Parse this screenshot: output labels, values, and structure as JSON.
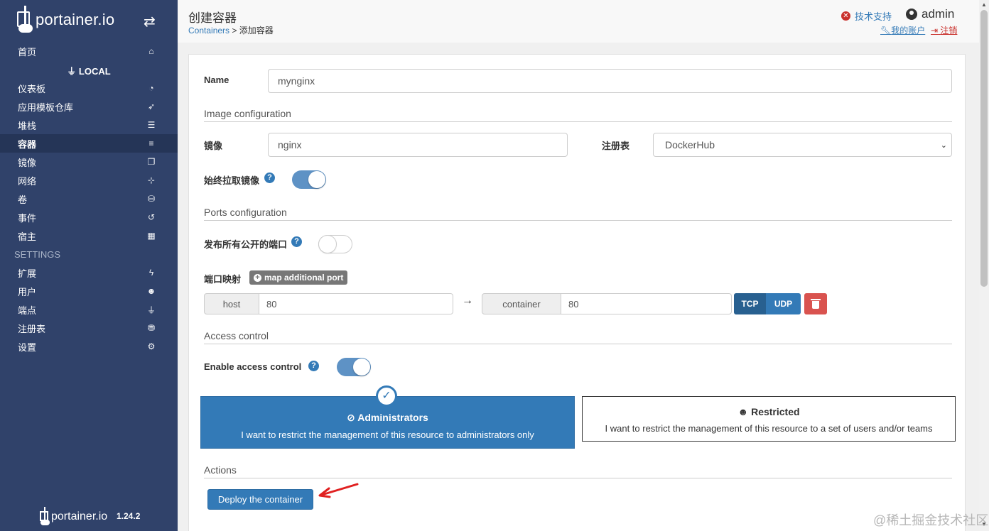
{
  "sidebar": {
    "logo_text": "portainer.io",
    "items_top": [
      {
        "label": "首页",
        "icon": "home-icon"
      }
    ],
    "local_label": "LOCAL",
    "items_local": [
      {
        "label": "仪表板",
        "icon": "dashboard-icon"
      },
      {
        "label": "应用模板仓库",
        "icon": "rocket-icon"
      },
      {
        "label": "堆栈",
        "icon": "th-list-icon"
      },
      {
        "label": "容器",
        "icon": "server-icon",
        "active": true
      },
      {
        "label": "镜像",
        "icon": "clone-icon"
      },
      {
        "label": "网络",
        "icon": "sitemap-icon"
      },
      {
        "label": "卷",
        "icon": "cubes-icon"
      },
      {
        "label": "事件",
        "icon": "history-icon"
      },
      {
        "label": "宿主",
        "icon": "th-icon"
      }
    ],
    "settings_label": "SETTINGS",
    "items_settings": [
      {
        "label": "扩展",
        "icon": "bolt-icon"
      },
      {
        "label": "用户",
        "icon": "users-icon"
      },
      {
        "label": "端点",
        "icon": "plug-icon"
      },
      {
        "label": "注册表",
        "icon": "database-icon"
      },
      {
        "label": "设置",
        "icon": "cogs-icon"
      }
    ],
    "footer_logo": "portainer.io",
    "version": "1.24.2"
  },
  "header": {
    "title": "创建容器",
    "breadcrumb_link": "Containers",
    "breadcrumb_sep": " > ",
    "breadcrumb_current": "添加容器",
    "support": "技术支持",
    "user": "admin",
    "my_account": "我的账户",
    "logout": "注销"
  },
  "form": {
    "name_label": "Name",
    "name_value": "mynginx",
    "image_section": "Image configuration",
    "image_label": "镜像",
    "image_value": "nginx",
    "registry_label": "注册表",
    "registry_value": "DockerHub",
    "always_pull_label": "始终拉取镜像",
    "always_pull": true,
    "ports_section": "Ports configuration",
    "publish_all_label": "发布所有公开的端口",
    "publish_all": false,
    "port_mapping_label": "端口映射",
    "map_port_button": "map additional port",
    "host_addon": "host",
    "host_value": "80",
    "container_addon": "container",
    "container_value": "80",
    "tcp": "TCP",
    "udp": "UDP",
    "access_section": "Access control",
    "enable_access_label": "Enable access control",
    "enable_access": true,
    "admin_title": "Administrators",
    "admin_desc": "I want to restrict the management of this resource to administrators only",
    "restricted_title": "Restricted",
    "restricted_desc": "I want to restrict the management of this resource to a set of users and/or teams",
    "actions_section": "Actions",
    "deploy_button": "Deploy the container"
  },
  "watermark": "@稀土掘金技术社区",
  "colors": {
    "sidebar": "#30426a",
    "primary": "#337ab7",
    "danger": "#d9534f"
  }
}
